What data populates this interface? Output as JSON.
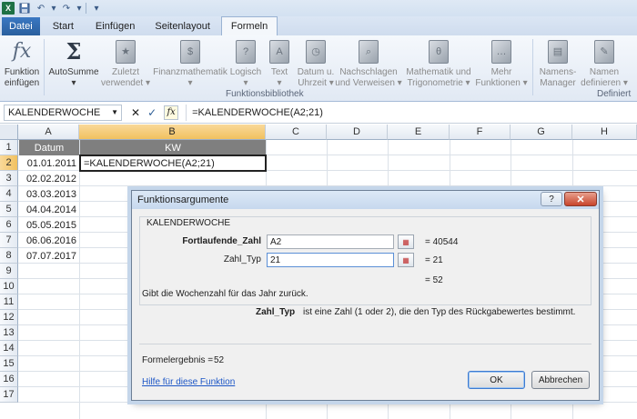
{
  "qat": {
    "undo": "↶",
    "redo": "↷",
    "sep": "|",
    "dropdown": "▾"
  },
  "tabs": [
    "Datei",
    "Start",
    "Einfügen",
    "Seitenlayout",
    "Formeln"
  ],
  "ribbon": {
    "buttons": [
      {
        "label1": "Funktion",
        "label2": "einfügen",
        "icon": "fx"
      },
      {
        "label1": "AutoSumme",
        "label2": "▾",
        "icon": "Σ"
      },
      {
        "label1": "Zuletzt",
        "label2": "verwendet ▾"
      },
      {
        "label1": "Finanzmathematik",
        "label2": "▾"
      },
      {
        "label1": "Logisch",
        "label2": "▾"
      },
      {
        "label1": "Text",
        "label2": "▾"
      },
      {
        "label1": "Datum u.",
        "label2": "Uhrzeit ▾"
      },
      {
        "label1": "Nachschlagen",
        "label2": "und Verweisen ▾"
      },
      {
        "label1": "Mathematik und",
        "label2": "Trigonometrie ▾"
      },
      {
        "label1": "Mehr",
        "label2": "Funktionen ▾"
      },
      {
        "label1": "Namens-",
        "label2": "Manager"
      },
      {
        "label1": "Namen",
        "label2": "definieren ▾"
      }
    ],
    "group_label_1": "Funktionsbibliothek",
    "group_label_2": "Definiert"
  },
  "formula_bar": {
    "name_box": "KALENDERWOCHE",
    "cancel": "✕",
    "enter": "✓",
    "fx": "fx",
    "formula": "=KALENDERWOCHE(A2;21)"
  },
  "grid": {
    "columns": [
      "A",
      "B",
      "C",
      "D",
      "E",
      "F",
      "G",
      "H"
    ],
    "rows": [
      "1",
      "2",
      "3",
      "4",
      "5",
      "6",
      "7",
      "8",
      "9",
      "10",
      "11",
      "12",
      "13",
      "14",
      "15",
      "16",
      "17"
    ],
    "header_a": "Datum",
    "header_b": "KW",
    "dates": [
      "01.01.2011",
      "02.02.2012",
      "03.03.2013",
      "04.04.2014",
      "05.05.2015",
      "06.06.2016",
      "07.07.2017"
    ],
    "b2": "=KALENDERWOCHE(A2;21)"
  },
  "dialog": {
    "title": "Funktionsargumente",
    "help": "?",
    "close": "✕",
    "function_name": "KALENDERWOCHE",
    "arg1_label": "Fortlaufende_Zahl",
    "arg1_value": "A2",
    "arg1_result": "= 40544",
    "arg2_label": "Zahl_Typ",
    "arg2_value": "21",
    "arg2_result": "= 21",
    "total_result": "= 52",
    "description": "Gibt die Wochenzahl für das Jahr zurück.",
    "param_name": "Zahl_Typ",
    "param_desc": "ist eine Zahl (1 oder 2), die den Typ des Rückgabewertes bestimmt.",
    "formula_result_label": "Formelergebnis =",
    "formula_result_value": "52",
    "help_link": "Hilfe für diese Funktion",
    "ok": "OK",
    "cancel": "Abbrechen"
  }
}
